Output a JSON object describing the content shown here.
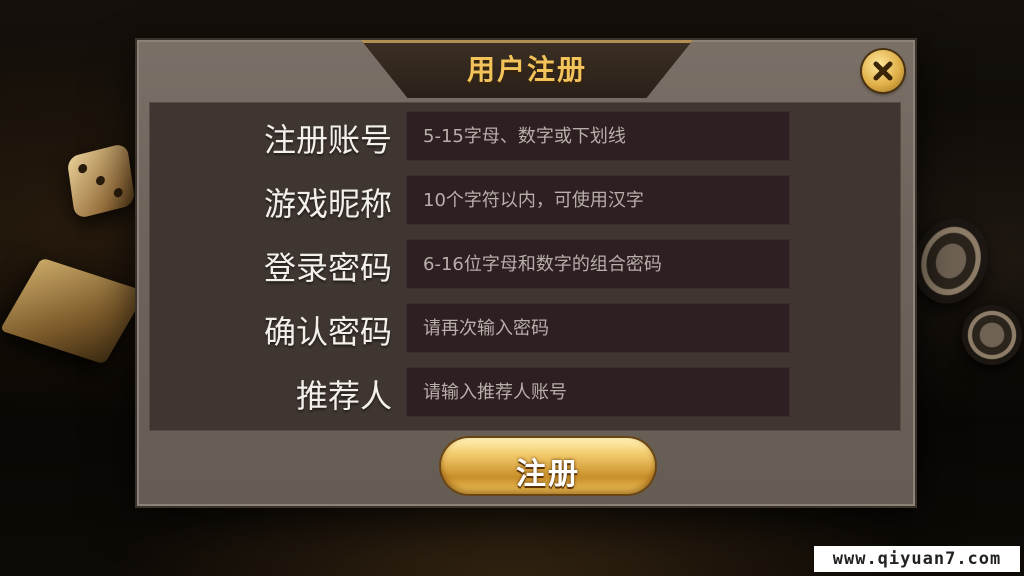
{
  "dialog": {
    "title": "用户注册",
    "close_icon": "close-icon"
  },
  "form": {
    "fields": [
      {
        "label": "注册账号",
        "placeholder": "5-15字母、数字或下划线"
      },
      {
        "label": "游戏昵称",
        "placeholder": "10个字符以内，可使用汉字"
      },
      {
        "label": "登录密码",
        "placeholder": "6-16位字母和数字的组合密码"
      },
      {
        "label": "确认密码",
        "placeholder": "请再次输入密码"
      },
      {
        "label": "推荐人",
        "placeholder": "请输入推荐人账号"
      }
    ]
  },
  "register_button": {
    "label": "注册"
  },
  "watermark": "www.qiyuan7.com",
  "colors": {
    "title_gold": "#f2c25b",
    "button_gold": "#e0b049",
    "panel_bg": "#3f3631",
    "input_bg": "#2d1f22"
  }
}
